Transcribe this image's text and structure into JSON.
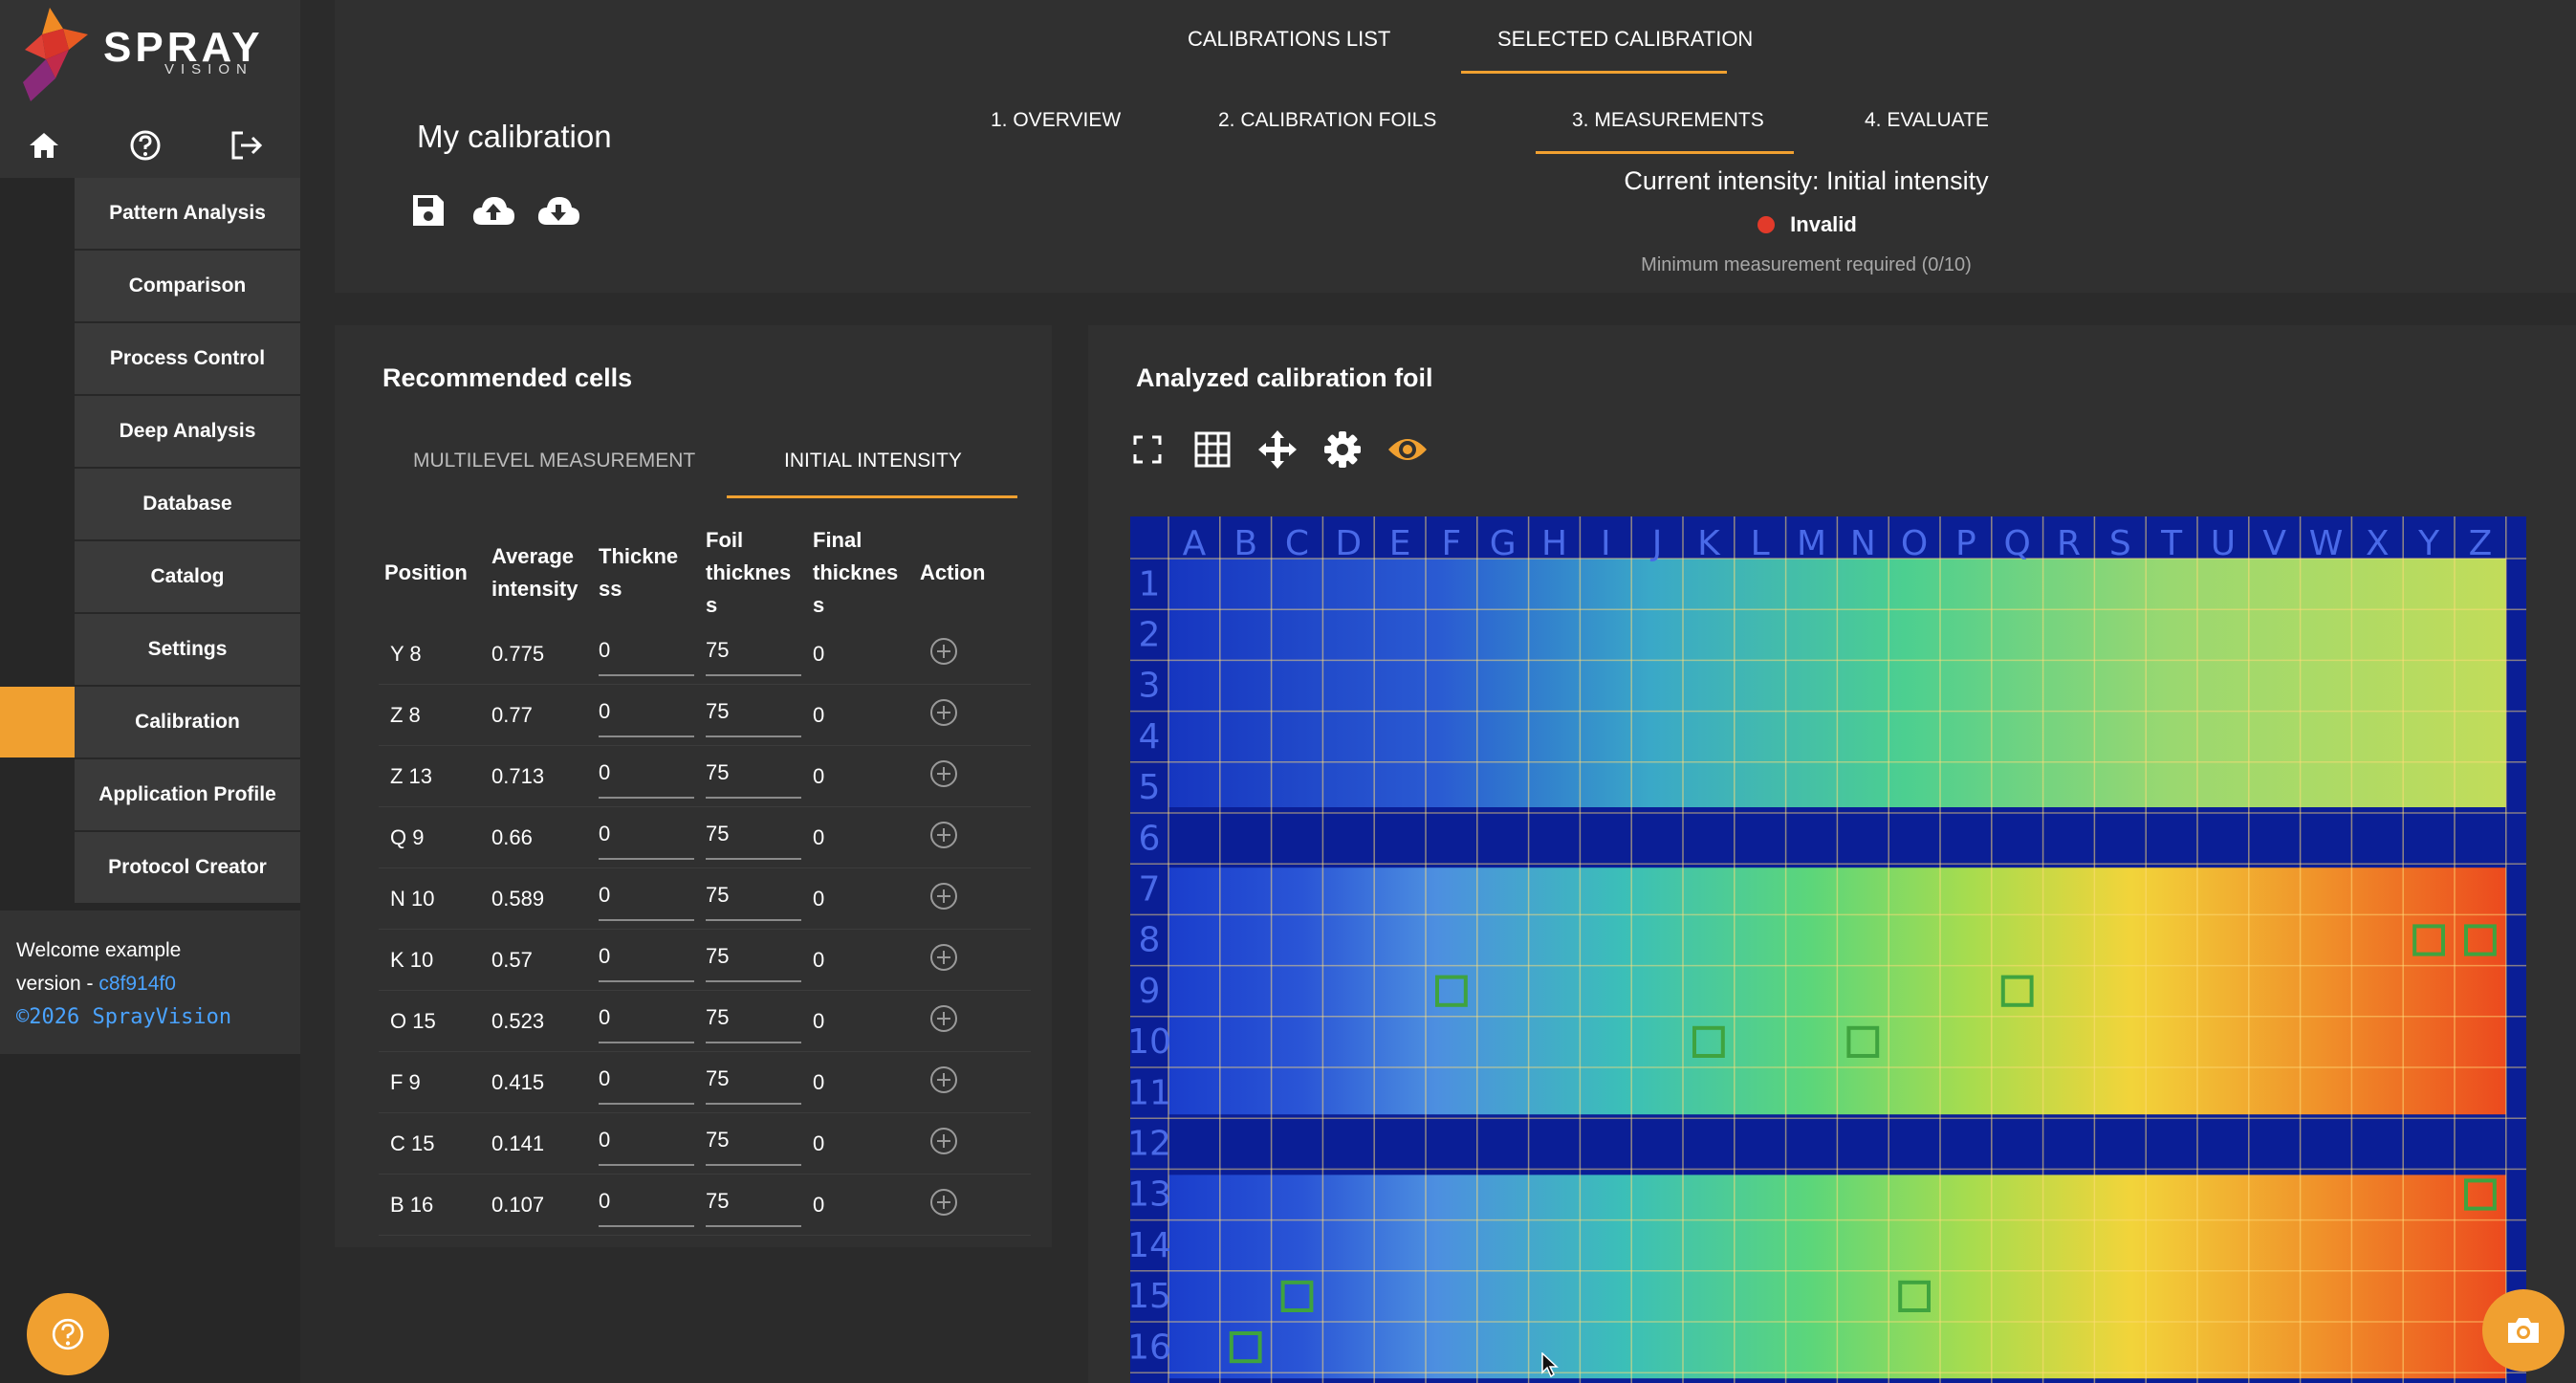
{
  "brand": {
    "name": "SPRAY",
    "sub": "VISION"
  },
  "sidebar": {
    "items": [
      {
        "label": "Pattern Analysis",
        "active": false
      },
      {
        "label": "Comparison",
        "active": false
      },
      {
        "label": "Process Control",
        "active": false
      },
      {
        "label": "Deep Analysis",
        "active": false
      },
      {
        "label": "Database",
        "active": false
      },
      {
        "label": "Catalog",
        "active": false
      },
      {
        "label": "Settings",
        "active": false
      },
      {
        "label": "Calibration",
        "active": true
      },
      {
        "label": "Application Profile",
        "active": false
      },
      {
        "label": "Protocol Creator",
        "active": false
      }
    ],
    "welcome": "Welcome example",
    "version_prefix": "version - ",
    "version": "c8f914f0",
    "copyright": "©2026 SprayVision"
  },
  "top_tabs": [
    {
      "label": "CALIBRATIONS LIST",
      "active": false
    },
    {
      "label": "SELECTED CALIBRATION",
      "active": true
    }
  ],
  "page_title": "My calibration",
  "steps": [
    {
      "label": "1. OVERVIEW",
      "active": false
    },
    {
      "label": "2. CALIBRATION FOILS",
      "active": false
    },
    {
      "label": "3. MEASUREMENTS",
      "active": true
    },
    {
      "label": "4. EVALUATE",
      "active": false
    }
  ],
  "status": {
    "current_intensity": "Current intensity: Initial intensity",
    "state": "Invalid",
    "minimum": "Minimum measurement required (0/10)"
  },
  "recommended": {
    "title": "Recommended cells",
    "tabs": [
      {
        "label": "MULTILEVEL MEASUREMENT",
        "active": false
      },
      {
        "label": "INITIAL INTENSITY",
        "active": true
      }
    ],
    "headers": {
      "position": "Position",
      "avg1": "Average",
      "avg2": "intensity",
      "thk1": "Thickne",
      "thk2": "ss",
      "foil1": "Foil",
      "foil2": "thicknes",
      "foil3": "s",
      "fin1": "Final",
      "fin2": "thicknes",
      "fin3": "s",
      "action": "Action"
    },
    "rows": [
      {
        "position": "Y 8",
        "avg": "0.775",
        "thickness": "0",
        "foil": "75",
        "final": "0"
      },
      {
        "position": "Z 8",
        "avg": "0.77",
        "thickness": "0",
        "foil": "75",
        "final": "0"
      },
      {
        "position": "Z 13",
        "avg": "0.713",
        "thickness": "0",
        "foil": "75",
        "final": "0"
      },
      {
        "position": "Q 9",
        "avg": "0.66",
        "thickness": "0",
        "foil": "75",
        "final": "0"
      },
      {
        "position": "N 10",
        "avg": "0.589",
        "thickness": "0",
        "foil": "75",
        "final": "0"
      },
      {
        "position": "K 10",
        "avg": "0.57",
        "thickness": "0",
        "foil": "75",
        "final": "0"
      },
      {
        "position": "O 15",
        "avg": "0.523",
        "thickness": "0",
        "foil": "75",
        "final": "0"
      },
      {
        "position": "F 9",
        "avg": "0.415",
        "thickness": "0",
        "foil": "75",
        "final": "0"
      },
      {
        "position": "C 15",
        "avg": "0.141",
        "thickness": "0",
        "foil": "75",
        "final": "0"
      },
      {
        "position": "B 16",
        "avg": "0.107",
        "thickness": "0",
        "foil": "75",
        "final": "0"
      }
    ]
  },
  "foil": {
    "title": "Analyzed calibration foil",
    "columns": [
      "A",
      "B",
      "C",
      "D",
      "E",
      "F",
      "G",
      "H",
      "I",
      "J",
      "K",
      "L",
      "M",
      "N",
      "O",
      "P",
      "Q",
      "R",
      "S",
      "T",
      "U",
      "V",
      "W",
      "X",
      "Y",
      "Z"
    ],
    "rows": [
      "1",
      "2",
      "3",
      "4",
      "5",
      "6",
      "7",
      "8",
      "9",
      "10",
      "11",
      "12",
      "13",
      "14",
      "15",
      "16"
    ],
    "highlighted": [
      {
        "col": "Y",
        "row": "8"
      },
      {
        "col": "Z",
        "row": "8"
      },
      {
        "col": "Z",
        "row": "13"
      },
      {
        "col": "Q",
        "row": "9"
      },
      {
        "col": "N",
        "row": "10"
      },
      {
        "col": "K",
        "row": "10"
      },
      {
        "col": "O",
        "row": "15"
      },
      {
        "col": "F",
        "row": "9"
      },
      {
        "col": "C",
        "row": "15"
      },
      {
        "col": "B",
        "row": "16"
      }
    ],
    "colors": {
      "accent": "#f0a030",
      "invalid": "#e23a2a",
      "marker": "#3fa33f"
    }
  }
}
